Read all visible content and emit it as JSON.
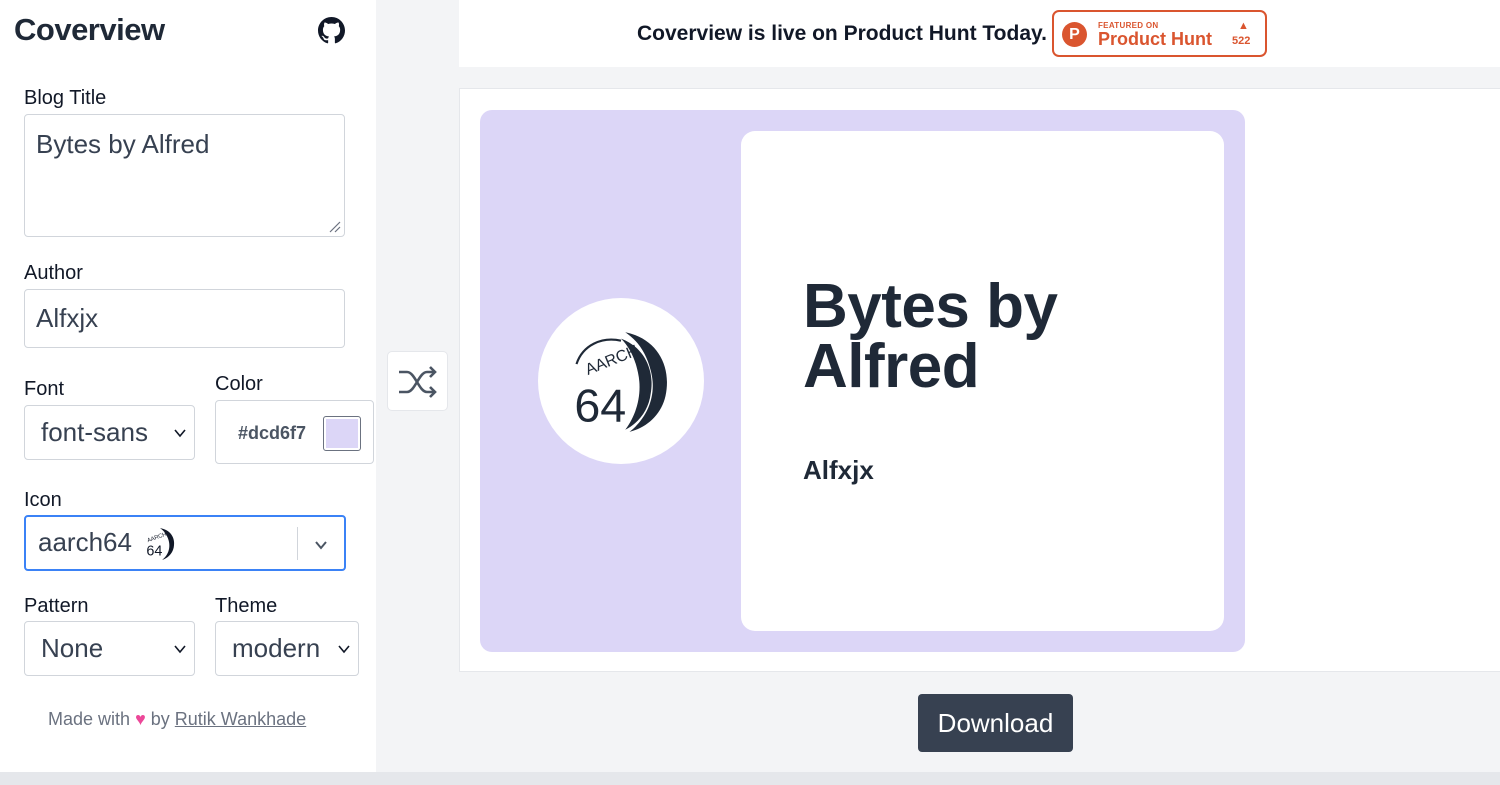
{
  "sidebar": {
    "brand": "Coverview",
    "blog_title_label": "Blog Title",
    "blog_title_value": "Bytes by Alfred",
    "author_label": "Author",
    "author_value": "Alfxjx",
    "font_label": "Font",
    "font_value": "font-sans",
    "color_label": "Color",
    "color_value": "#dcd6f7",
    "icon_label": "Icon",
    "icon_value": "aarch64",
    "pattern_label": "Pattern",
    "pattern_value": "None",
    "theme_label": "Theme",
    "theme_value": "modern",
    "footer_prefix": "Made with",
    "footer_by": "by",
    "footer_author": "Rutik Wankhade"
  },
  "banner": {
    "text": "Coverview is live on Product Hunt Today.",
    "badge_featured": "FEATURED ON",
    "badge_name": "Product Hunt",
    "badge_letter": "P",
    "badge_count": "522"
  },
  "cover": {
    "title": "Bytes by Alfred",
    "author": "Alfxjx",
    "logo_text_top": "AARCH",
    "logo_text_num": "64"
  },
  "actions": {
    "download": "Download"
  },
  "colors": {
    "cover_bg": "#dcd6f7",
    "accent_focus": "#3b82f6",
    "producthunt": "#da552f",
    "button_dark": "#374151"
  },
  "icons": {
    "github": "github-icon",
    "shuffle": "shuffle-icon",
    "chevron": "chevron-down-icon",
    "heart": "heart-icon",
    "aarch64": "aarch64-logo"
  }
}
